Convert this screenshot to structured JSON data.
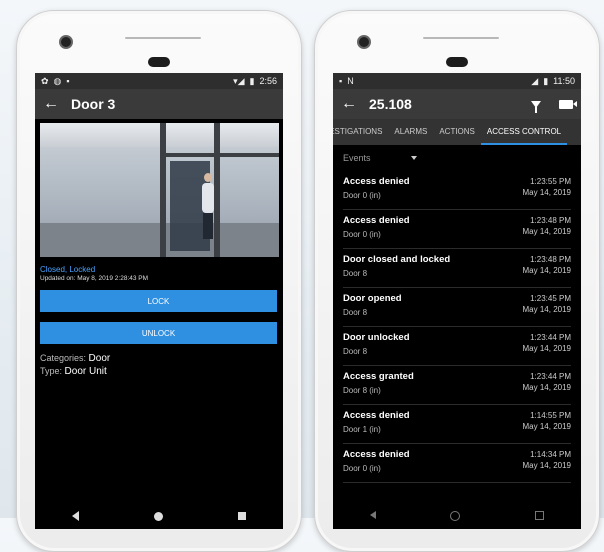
{
  "left": {
    "status_time": "2:56",
    "title": "Door 3",
    "state": "Closed, Locked",
    "updated": "Updated on: May 8, 2019 2:28:43 PM",
    "lock_label": "LOCK",
    "unlock_label": "UNLOCK",
    "categories_label": "Categories:",
    "categories_value": "Door",
    "type_label": "Type:",
    "type_value": "Door Unit"
  },
  "right": {
    "status_time": "11:50",
    "title": "25.108",
    "tabs": [
      "/ESTIGATIONS",
      "ALARMS",
      "ACTIONS",
      "ACCESS CONTROL"
    ],
    "filter": "Events",
    "events": [
      {
        "title": "Access denied",
        "sub": "Door 0 (in)",
        "time": "1:23:55 PM",
        "date": "May 14, 2019"
      },
      {
        "title": "Access denied",
        "sub": "Door 0 (in)",
        "time": "1:23:48 PM",
        "date": "May 14, 2019"
      },
      {
        "title": "Door closed and locked",
        "sub": "Door 8",
        "time": "1:23:48 PM",
        "date": "May 14, 2019"
      },
      {
        "title": "Door opened",
        "sub": "Door 8",
        "time": "1:23:45 PM",
        "date": "May 14, 2019"
      },
      {
        "title": "Door unlocked",
        "sub": "Door 8",
        "time": "1:23:44 PM",
        "date": "May 14, 2019"
      },
      {
        "title": "Access granted",
        "sub": "Door 8 (in)",
        "time": "1:23:44 PM",
        "date": "May 14, 2019"
      },
      {
        "title": "Access denied",
        "sub": "Door 1 (in)",
        "time": "1:14:55 PM",
        "date": "May 14, 2019"
      },
      {
        "title": "Access denied",
        "sub": "Door 0 (in)",
        "time": "1:14:34 PM",
        "date": "May 14, 2019"
      }
    ]
  },
  "icons": [
    "back-arrow-icon",
    "filter-icon",
    "video-icon",
    "wifi-icon",
    "battery-icon"
  ],
  "colors": {
    "accent": "#2f8fe0",
    "state_text": "#4aa3ff",
    "appbar": "#3a3a3a"
  }
}
